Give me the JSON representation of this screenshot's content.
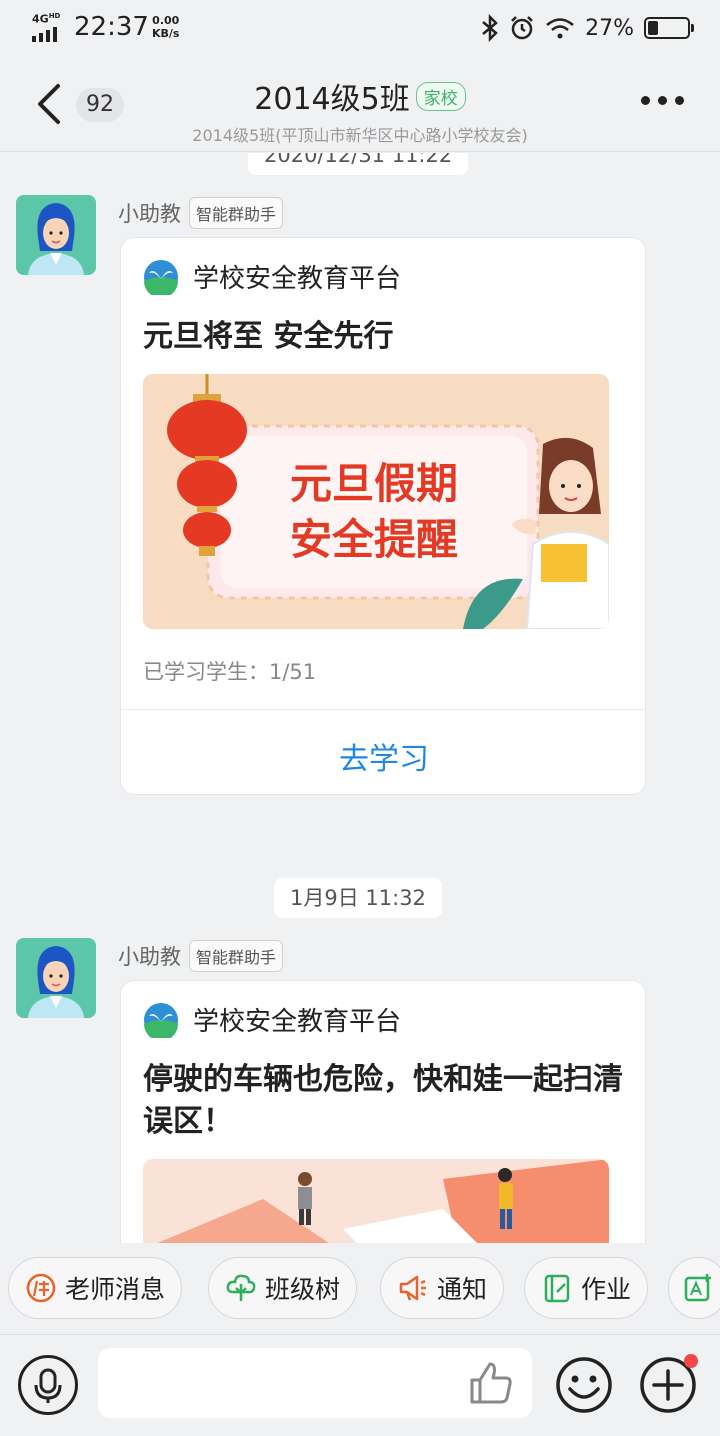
{
  "status_bar": {
    "network": "4G",
    "network_badge": "HD",
    "time": "22:37",
    "speed_value": "0.00",
    "speed_unit": "KB/s",
    "battery_pct": "27%",
    "battery_level": 0.27,
    "icons": [
      "bluetooth-icon",
      "alarm-icon",
      "wifi-icon",
      "battery-icon"
    ]
  },
  "header": {
    "unread_count": "92",
    "title": "2014级5班",
    "tag": "家校",
    "subtitle": "2014级5班(平顶山市新华区中心路小学校友会)"
  },
  "messages": [
    {
      "timestamp": "2020/12/31 11:22",
      "sender": "小助教",
      "sender_tag": "智能群助手",
      "source": "学校安全教育平台",
      "title": "元旦将至  安全先行",
      "banner_line1": "元旦假期",
      "banner_line2": "安全提醒",
      "learned": "已学习学生：1/51",
      "action": "去学习"
    },
    {
      "timestamp": "1月9日 11:32",
      "sender": "小助教",
      "sender_tag": "智能群助手",
      "source": "学校安全教育平台",
      "title": "停驶的车辆也危险，快和娃一起扫清误区！"
    }
  ],
  "quick_actions": [
    {
      "label": "老师消息",
      "icon": "teacher-icon",
      "color": "#e8632d"
    },
    {
      "label": "班级树",
      "icon": "tree-icon",
      "color": "#2fae5b"
    },
    {
      "label": "通知",
      "icon": "megaphone-icon",
      "color": "#e8632d"
    },
    {
      "label": "作业",
      "icon": "homework-icon",
      "color": "#2fae5b"
    }
  ],
  "colors": {
    "accent_blue": "#1e88e5",
    "green": "#3fb06a",
    "notify_red": "#f04848"
  }
}
